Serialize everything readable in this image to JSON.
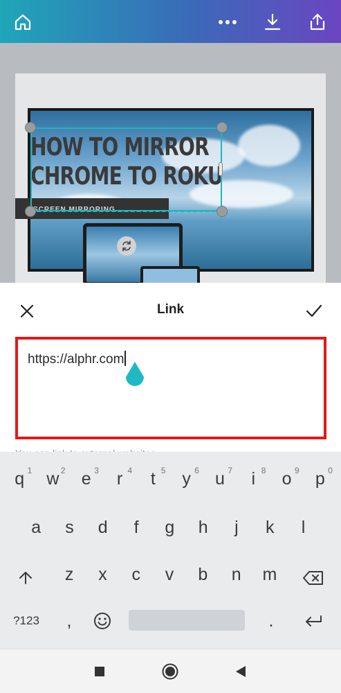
{
  "topbar": {
    "home_icon": "home-icon",
    "more_icon": "more-horizontal-icon",
    "download_icon": "download-icon",
    "share_icon": "share-icon"
  },
  "canvas": {
    "headline_line1": "HOW TO MIRROR",
    "headline_line2": "CHROME TO ROKU",
    "tag": "SCREEN MIRRORING"
  },
  "sheet": {
    "title": "Link",
    "close_icon": "close-icon",
    "confirm_icon": "check-icon",
    "link_value": "https://alphr.com",
    "hint": "You can link to external websites"
  },
  "keyboard": {
    "row1": [
      {
        "key": "q",
        "hint": "1"
      },
      {
        "key": "w",
        "hint": "2"
      },
      {
        "key": "e",
        "hint": "3"
      },
      {
        "key": "r",
        "hint": "4"
      },
      {
        "key": "t",
        "hint": "5"
      },
      {
        "key": "y",
        "hint": "6"
      },
      {
        "key": "u",
        "hint": "7"
      },
      {
        "key": "i",
        "hint": "8"
      },
      {
        "key": "o",
        "hint": "9"
      },
      {
        "key": "p",
        "hint": "0"
      }
    ],
    "row2": [
      "a",
      "s",
      "d",
      "f",
      "g",
      "h",
      "j",
      "k",
      "l"
    ],
    "row3": [
      "z",
      "x",
      "c",
      "v",
      "b",
      "n",
      "m"
    ],
    "sym_label": "?123",
    "comma": ",",
    "period": ".",
    "shift_icon": "shift-arrow-icon",
    "backspace_icon": "backspace-icon",
    "emoji_icon": "emoji-icon",
    "enter_icon": "enter-icon"
  },
  "navbar": {
    "recents_icon": "recents-square-icon",
    "home_icon": "home-circle-icon",
    "back_icon": "back-triangle-icon"
  },
  "colors": {
    "topbar_start": "#1fa6b8",
    "topbar_end": "#6b45c2",
    "selection": "#20b6bf",
    "highlight_border": "#e01a1a"
  }
}
